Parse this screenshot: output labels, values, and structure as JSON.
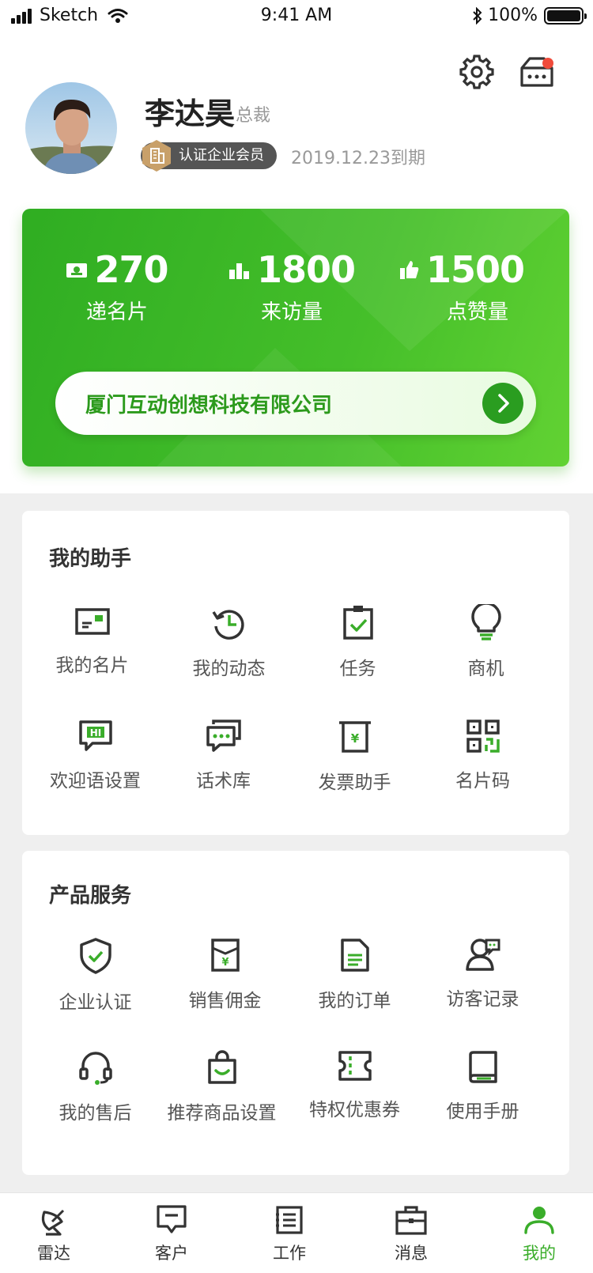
{
  "status_bar": {
    "carrier": "Sketch",
    "time": "9:41 AM",
    "battery": "100%"
  },
  "profile": {
    "name": "李达昊",
    "title": "总裁",
    "badge": "认证企业会员",
    "expire": "2019.12.23到期"
  },
  "stats": [
    {
      "value": "270",
      "label": "递名片",
      "icon": "card-icon"
    },
    {
      "value": "1800",
      "label": "来访量",
      "icon": "bar-chart-icon"
    },
    {
      "value": "1500",
      "label": "点赞量",
      "icon": "thumbs-up-icon"
    }
  ],
  "company": {
    "name": "厦门互动创想科技有限公司"
  },
  "assistant": {
    "title": "我的助手",
    "items": [
      "我的名片",
      "我的动态",
      "任务",
      "商机",
      "欢迎语设置",
      "话术库",
      "发票助手",
      "名片码"
    ]
  },
  "services": {
    "title": "产品服务",
    "items": [
      "企业认证",
      "销售佣金",
      "我的订单",
      "访客记录",
      "我的售后",
      "推荐商品设置",
      "特权优惠券",
      "使用手册"
    ]
  },
  "tabbar": {
    "items": [
      "雷达",
      "客户",
      "工作",
      "消息",
      "我的"
    ],
    "active": "我的"
  },
  "colors": {
    "accent": "#3aad2a",
    "card_start": "#2fad22",
    "card_end": "#62d233",
    "badge_red": "#f04b3b"
  }
}
